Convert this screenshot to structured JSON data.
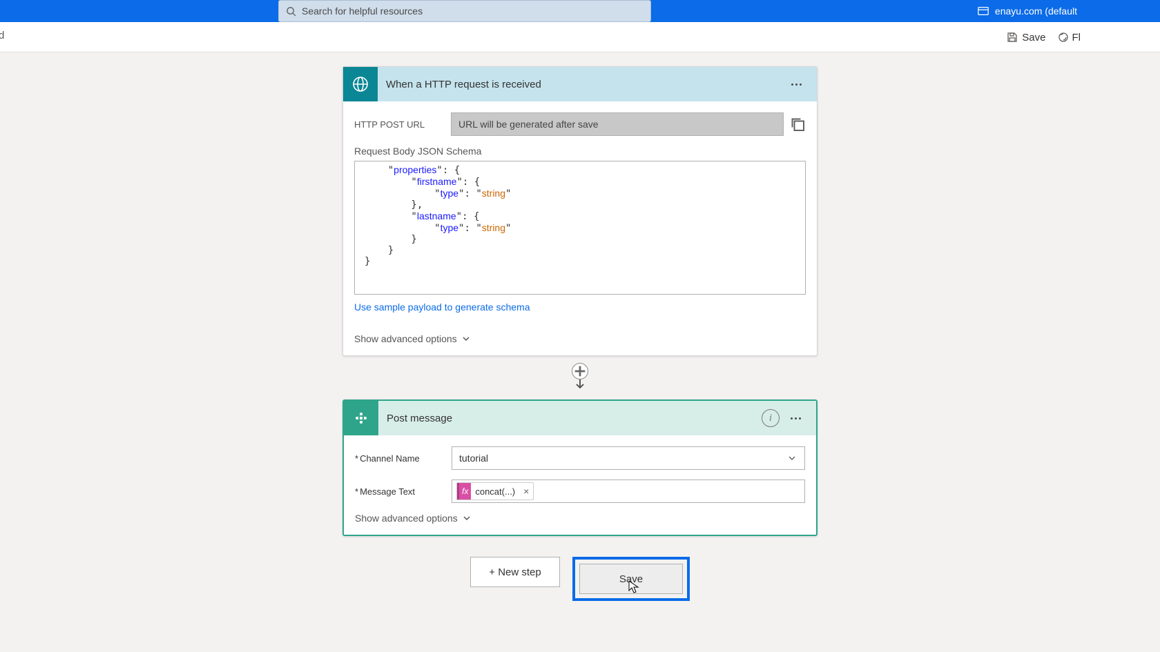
{
  "topbar": {
    "search_placeholder": "Search for helpful resources",
    "tenant": "enayu.com (default"
  },
  "cmdbar": {
    "left_fragment": "d",
    "save": "Save",
    "flow_fragment": "Fl"
  },
  "trigger": {
    "title": "When a HTTP request is received",
    "url_label": "HTTP POST URL",
    "url_value": "URL will be generated after save",
    "schema_label": "Request Body JSON Schema",
    "sample_link": "Use sample payload to generate schema",
    "advanced": "Show advanced options"
  },
  "schema_lines": [
    {
      "indent": 2,
      "plain": "\"",
      "key": "properties",
      "plain2": "\": {"
    },
    {
      "indent": 4,
      "plain": "\"",
      "key": "firstname",
      "plain2": "\": {"
    },
    {
      "indent": 6,
      "plain": "\"",
      "key": "type",
      "plain2": "\": \"",
      "val": "string",
      "plain3": "\""
    },
    {
      "indent": 4,
      "plain": "},"
    },
    {
      "indent": 4,
      "plain": "\"",
      "key": "lastname",
      "plain2": "\": {"
    },
    {
      "indent": 6,
      "plain": "\"",
      "key": "type",
      "plain2": "\": \"",
      "val": "string",
      "plain3": "\""
    },
    {
      "indent": 4,
      "plain": "}"
    },
    {
      "indent": 2,
      "plain": "}"
    },
    {
      "indent": 0,
      "plain": "}"
    }
  ],
  "action": {
    "title": "Post message",
    "channel_label": "Channel Name",
    "channel_value": "tutorial",
    "message_label": "Message Text",
    "token_fx": "fx",
    "token_text": "concat(...)",
    "advanced": "Show advanced options"
  },
  "bottom": {
    "new_step": "+ New step",
    "save": "Save"
  }
}
